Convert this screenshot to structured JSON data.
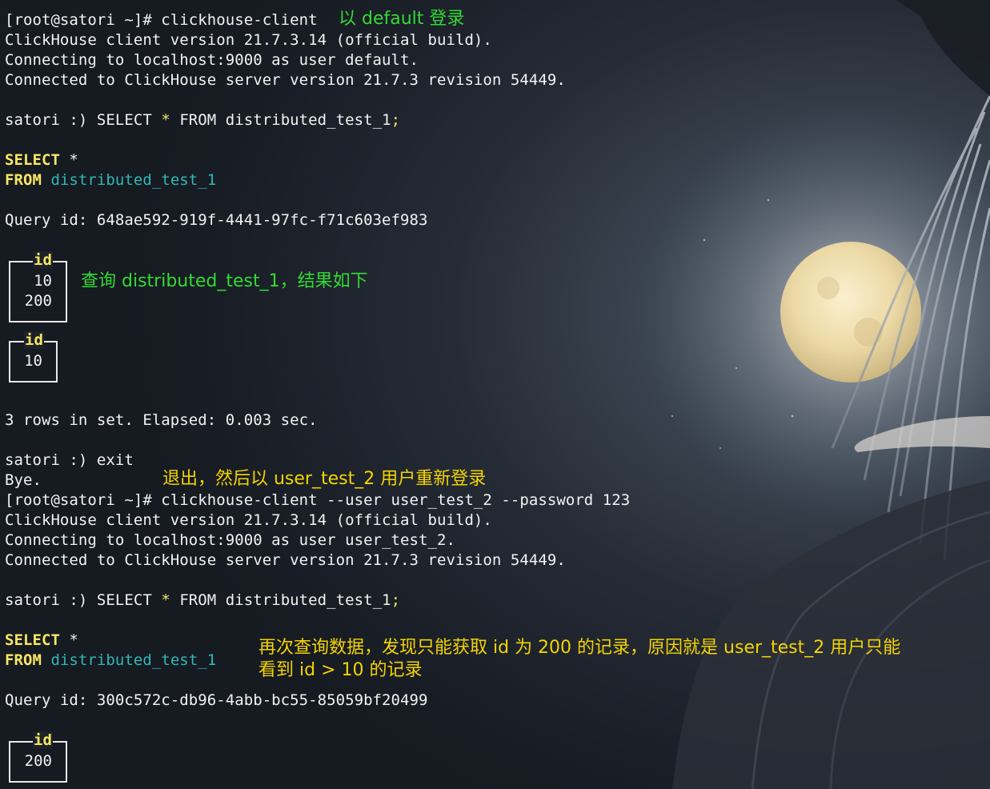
{
  "session1": {
    "prompt_login": "[root@satori ~]# clickhouse-client",
    "note_login": "以 default 登录",
    "version_line": "ClickHouse client version 21.7.3.14 (official build).",
    "connecting_line": "Connecting to localhost:9000 as user default.",
    "connected_line": "Connected to ClickHouse server version 21.7.3 revision 54449.",
    "query_prompt": "satori :) ",
    "query_select": "SELECT ",
    "query_star": "*",
    "query_from": " FROM distributed_test_1",
    "query_semicolon": ";",
    "fmt_select": "SELECT",
    "fmt_star": " *",
    "fmt_from": "FROM",
    "fmt_table": " distributed_test_1",
    "query_id": "Query id: 648ae592-919f-4441-97fc-f71c603ef983",
    "result_header": "id",
    "result_block1": [
      "10",
      "200"
    ],
    "result_block2": [
      "10"
    ],
    "note_result": "查询 distributed_test_1，结果如下",
    "rows_line": "3 rows in set. Elapsed: 0.003 sec.",
    "exit_cmd": "satori :) exit",
    "bye": "Bye.",
    "note_exit": "退出，然后以 user_test_2 用户重新登录"
  },
  "session2": {
    "prompt_login": "[root@satori ~]# clickhouse-client --user user_test_2 --password 123",
    "version_line": "ClickHouse client version 21.7.3.14 (official build).",
    "connecting_line": "Connecting to localhost:9000 as user user_test_2.",
    "connected_line": "Connected to ClickHouse server version 21.7.3 revision 54449.",
    "query_prompt": "satori :) ",
    "query_select": "SELECT ",
    "query_star": "*",
    "query_from": " FROM distributed_test_1",
    "query_semicolon": ";",
    "fmt_select": "SELECT",
    "fmt_star": " *",
    "fmt_from": "FROM",
    "fmt_table": " distributed_test_1",
    "note_line1": "再次查询数据，发现只能获取 id 为 200 的记录，原因就是 user_test_2 用户只能",
    "note_line2": "看到 id > 10 的记录",
    "query_id": "Query id: 300c572c-db96-4abb-bc55-85059bf20499",
    "result_header": "id",
    "result_block1": [
      "200"
    ]
  },
  "colors": {
    "keyword": "#f5e663",
    "table_name": "#2fb8b8",
    "note_green": "#33d933",
    "note_yellow": "#f3d400",
    "text": "#f2f2f2"
  }
}
